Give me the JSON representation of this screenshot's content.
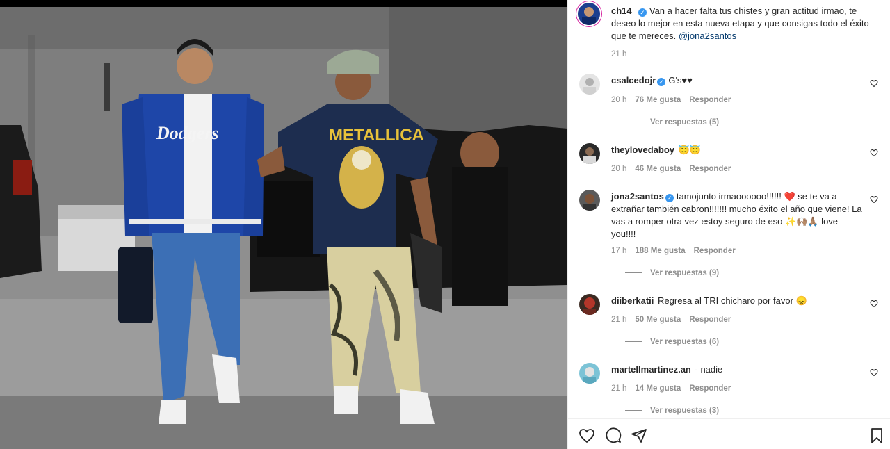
{
  "post": {
    "author": "ch14_",
    "caption": "Van a hacer falta tus chistes y gran actitud irmao, te deseo lo mejor en esta nueva etapa y que consigas todo el éxito que te mereces.",
    "caption_mention": "@jona2santos",
    "time": "21 h"
  },
  "photo": {
    "jacket_text": "Dodgers",
    "shirt_text": "METALLICA"
  },
  "comments": [
    {
      "user": "csalcedojr",
      "verified": true,
      "text": "G's♥♥",
      "time": "20 h",
      "likes": "76 Me gusta",
      "reply": "Responder",
      "replies": "Ver respuestas (5)"
    },
    {
      "user": "theylovedaboy",
      "verified": false,
      "text": "😇😇",
      "time": "20 h",
      "likes": "46 Me gusta",
      "reply": "Responder",
      "replies": ""
    },
    {
      "user": "jona2santos",
      "verified": true,
      "text": "tamojunto irmaoooooo!!!!!! ❤️ se te va a extrañar también cabron!!!!!!! mucho éxito el año que viene! La vas a romper otra vez estoy seguro de eso ✨🙌🏽🙏🏽 love you!!!!",
      "time": "17 h",
      "likes": "188 Me gusta",
      "reply": "Responder",
      "replies": "Ver respuestas (9)"
    },
    {
      "user": "diiberkatii",
      "verified": false,
      "text": "Regresa al TRI chicharo por favor 😞",
      "time": "21 h",
      "likes": "50 Me gusta",
      "reply": "Responder",
      "replies": "Ver respuestas (6)"
    },
    {
      "user": "martellmartinez.an",
      "verified": false,
      "text": "- nadie",
      "time": "21 h",
      "likes": "14 Me gusta",
      "reply": "Responder",
      "replies": "Ver respuestas (3)"
    }
  ],
  "icons": {
    "like": "heart-icon",
    "comment": "comment-icon",
    "share": "send-icon",
    "save": "bookmark-icon"
  },
  "colors": {
    "verified": "#3897f0",
    "mention": "#00376b",
    "secondary_text": "#8e8e8e"
  }
}
